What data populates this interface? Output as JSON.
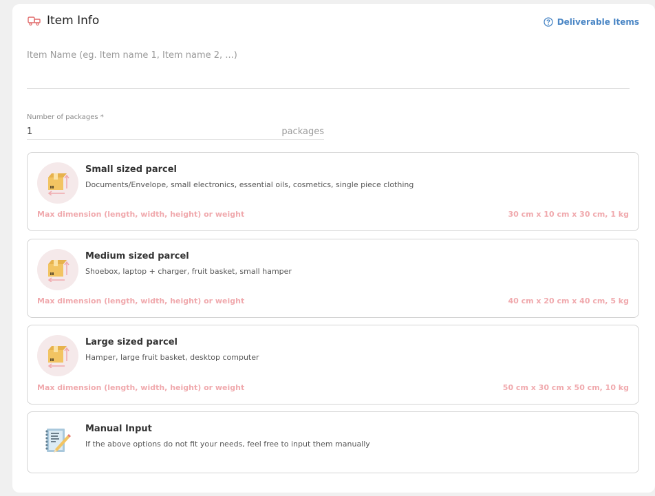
{
  "header": {
    "title": "Item Info",
    "help_link": "Deliverable Items",
    "title_icon": "parcel-tag-icon",
    "help_icon": "question-circle-icon"
  },
  "item_name": {
    "placeholder": "Item Name (eg. Item name 1, Item name 2, ...)",
    "value": ""
  },
  "packages": {
    "label": "Number of packages *",
    "value": "1",
    "unit": "packages"
  },
  "dimension_label": "Max dimension (length, width, height) or weight",
  "options": [
    {
      "title": "Small sized parcel",
      "description": "Documents/Envelope, small electronics, essential oils, cosmetics, single piece clothing",
      "dimension_value": "30 cm x 10 cm x 30 cm, 1 kg",
      "icon": "box-icon"
    },
    {
      "title": "Medium sized parcel",
      "description": "Shoebox, laptop + charger, fruit basket, small hamper",
      "dimension_value": "40 cm x 20 cm x 40 cm, 5 kg",
      "icon": "box-icon"
    },
    {
      "title": "Large sized parcel",
      "description": "Hamper, large fruit basket, desktop computer",
      "dimension_value": "50 cm x 30 cm x 50 cm, 10 kg",
      "icon": "box-icon"
    },
    {
      "title": "Manual Input",
      "description": "If the above options do not fit your needs, feel free to input them manually",
      "icon": "notepad-pencil-icon"
    }
  ],
  "colors": {
    "accent_blue": "#4a86c5",
    "dimension_pink": "#f0a9ad",
    "icon_circle": "#f5e9ea",
    "box_yellow": "#f2c462"
  }
}
